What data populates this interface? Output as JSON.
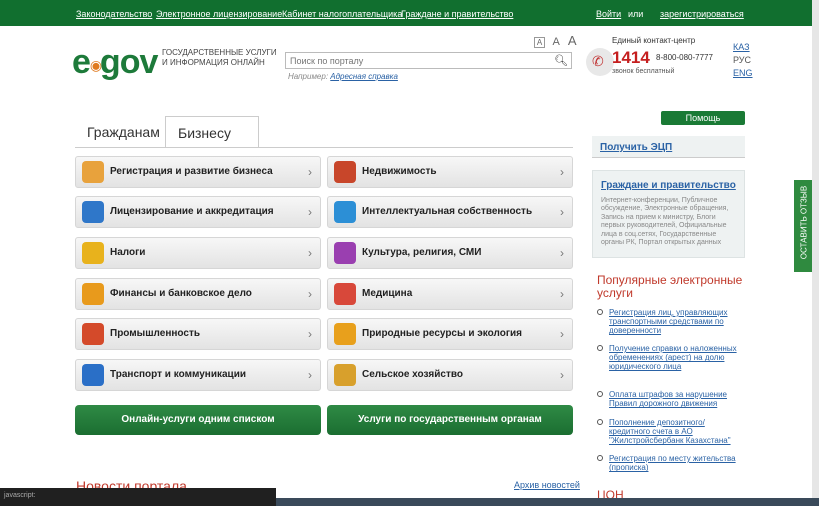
{
  "topbar": {
    "links": [
      "Законодательство",
      "Электронное лицензирование",
      "Кабинет налогоплательщика",
      "Граждане и правительство"
    ],
    "login": "Войти",
    "or": "или",
    "register": "зарегистрироваться"
  },
  "header": {
    "logo": "egov",
    "tagline_1": "ГОСУДАРСТВЕННЫЕ УСЛУГИ",
    "tagline_2": "И ИНФОРМАЦИЯ ОНЛАЙН",
    "search_placeholder": "Поиск по порталу",
    "example_prefix": "Например:",
    "example_link": "Адресная справка",
    "font_sizes": [
      "A",
      "A",
      "A"
    ],
    "contact_title": "Единый контакт-центр",
    "contact_number": "1414",
    "contact_alt": "8-800-080-7777",
    "contact_free": "звонок бесплатный",
    "languages": [
      "КАЗ",
      "РУС",
      "ENG"
    ]
  },
  "tabs": [
    "Гражданам",
    "Бизнесу"
  ],
  "categories": {
    "left": [
      {
        "label": "Регистрация и развитие бизнеса",
        "icon": "briefcase-icon",
        "color": "#e8a23c"
      },
      {
        "label": "Лицензирование и аккредитация",
        "icon": "license-icon",
        "color": "#2f77c9"
      },
      {
        "label": "Налоги",
        "icon": "percent-icon",
        "color": "#e8b21c"
      },
      {
        "label": "Финансы и банковское дело",
        "icon": "coins-icon",
        "color": "#e89a1c"
      },
      {
        "label": "Промышленность",
        "icon": "trowel-icon",
        "color": "#d44a2a"
      },
      {
        "label": "Транспорт и коммуникации",
        "icon": "truck-icon",
        "color": "#2a6fc7"
      }
    ],
    "right": [
      {
        "label": "Недвижимость",
        "icon": "house-icon",
        "color": "#c8462a"
      },
      {
        "label": "Интеллектуальная собственность",
        "icon": "copyright-icon",
        "color": "#2c8fd6"
      },
      {
        "label": "Культура, религия, СМИ",
        "icon": "culture-icon",
        "color": "#9a3fb0"
      },
      {
        "label": "Медицина",
        "icon": "medical-cross-icon",
        "color": "#d8483a"
      },
      {
        "label": "Природные ресурсы и экология",
        "icon": "tree-icon",
        "color": "#e8a01c"
      },
      {
        "label": "Сельское хозяйство",
        "icon": "wheat-icon",
        "color": "#d8a02c"
      }
    ],
    "chevron": "›"
  },
  "buttons": {
    "online_list": "Онлайн-услуги одним списком",
    "by_agency": "Услуги по государственным органам"
  },
  "news": {
    "title": "Новости портала",
    "archive": "Архив новостей"
  },
  "sidebar": {
    "help": "Помощь",
    "ecp": "Получить ЭЦП",
    "gov_title": "Граждане и правительство",
    "gov_desc": "Интернет-конференции, Публичное обсуждение, Электронные обращения, Запись на прием к министру, Блоги первых руководителей, Официальные лица в соц.сетях, Государственные органы РК, Портал открытых данных",
    "popular_title": "Популярные электронные услуги",
    "popular": [
      "Регистрация лиц, управляющих транспортными средствами по доверенности",
      "Получение справки о наложенных обременениях (арест) на долю юридического лица",
      "Оплата штрафов за нарушение Правил дорожного движения",
      "Пополнение депозитного/ кредитного счета в АО \"Жилстройсбербанк Казахстана\"",
      "Регистрация по месту жительства (прописка)"
    ],
    "con_title": "ЦОН"
  },
  "feedback": "ОСТАВИТЬ ОТЗЫВ",
  "status": "javascript:"
}
